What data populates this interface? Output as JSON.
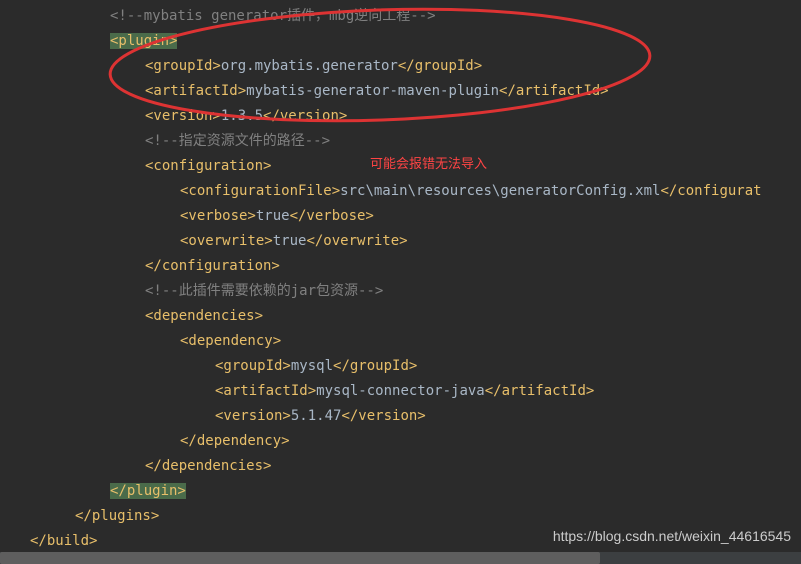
{
  "code": {
    "line1_comment": "<!--mybatis generator插件，mbg逆向工程-->",
    "line2_open": "<plugin>",
    "line3": {
      "open": "<groupId>",
      "text": "org.mybatis.generator",
      "close": "</groupId>"
    },
    "line4": {
      "open": "<artifactId>",
      "text": "mybatis-generator-maven-plugin",
      "close": "</artifactId>"
    },
    "line5": {
      "open": "<version>",
      "text": "1.3.5",
      "close": "</version>"
    },
    "line6_comment": "<!--指定资源文件的路径-->",
    "line7_open": "<configuration>",
    "line8": {
      "open": "<configurationFile>",
      "text": "src\\main\\resources\\generatorConfig.xml",
      "close": "</configurat"
    },
    "line9": {
      "open": "<verbose>",
      "text": "true",
      "close": "</verbose>"
    },
    "line10": {
      "open": "<overwrite>",
      "text": "true",
      "close": "</overwrite>"
    },
    "line11_close": "</configuration>",
    "line12_comment": "<!--此插件需要依赖的jar包资源-->",
    "line13_open": "<dependencies>",
    "line14_open": "<dependency>",
    "line15": {
      "open": "<groupId>",
      "text": "mysql",
      "close": "</groupId>"
    },
    "line16": {
      "open": "<artifactId>",
      "text": "mysql-connector-java",
      "close": "</artifactId>"
    },
    "line17": {
      "open": "<version>",
      "text": "5.1.47",
      "close": "</version>"
    },
    "line18_close": "</dependency>",
    "line19_close": "</dependencies>",
    "line20_close": "</plugin>",
    "line21_close": "</plugins>",
    "line22_close": "</build>"
  },
  "annotation": "可能会报错无法导入",
  "watermark": "https://blog.csdn.net/weixin_44616545"
}
